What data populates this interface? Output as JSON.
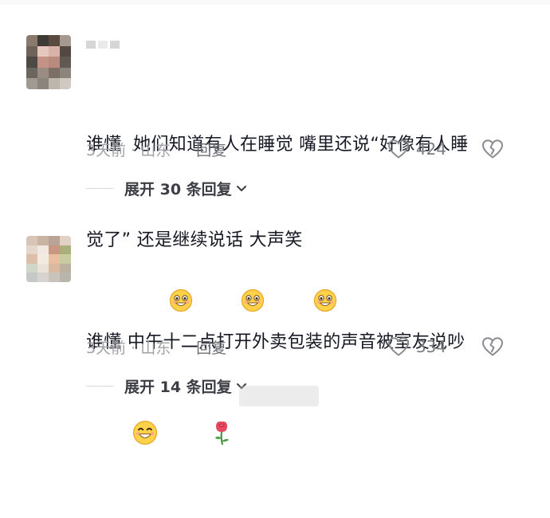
{
  "comments": [
    {
      "text_line1": "谁懂  她们知道有人在睡觉 嘴里还说“好像有人睡",
      "text_line2": "觉了” 还是继续说话 大声笑",
      "emojis": [
        "grin-icon",
        "grin-icon",
        "grin-icon"
      ],
      "time": "3天前 · 山东",
      "reply_label": "回复",
      "like_count": "424",
      "expand_label": "展开 30 条回复"
    },
    {
      "text_line1": "谁懂 中午十二点打开外卖包装的声音被室友说吵",
      "emojis": [
        "smile-icon",
        "rose-icon"
      ],
      "time": "3天前 · 山东",
      "reply_label": "回复",
      "like_count": "334",
      "expand_label": "展开 14 条回复"
    }
  ],
  "colors": {
    "text": "#161823",
    "secondary": "#8a8b91",
    "emoji_face": "#ffd24a",
    "rose": "#e8485f"
  }
}
